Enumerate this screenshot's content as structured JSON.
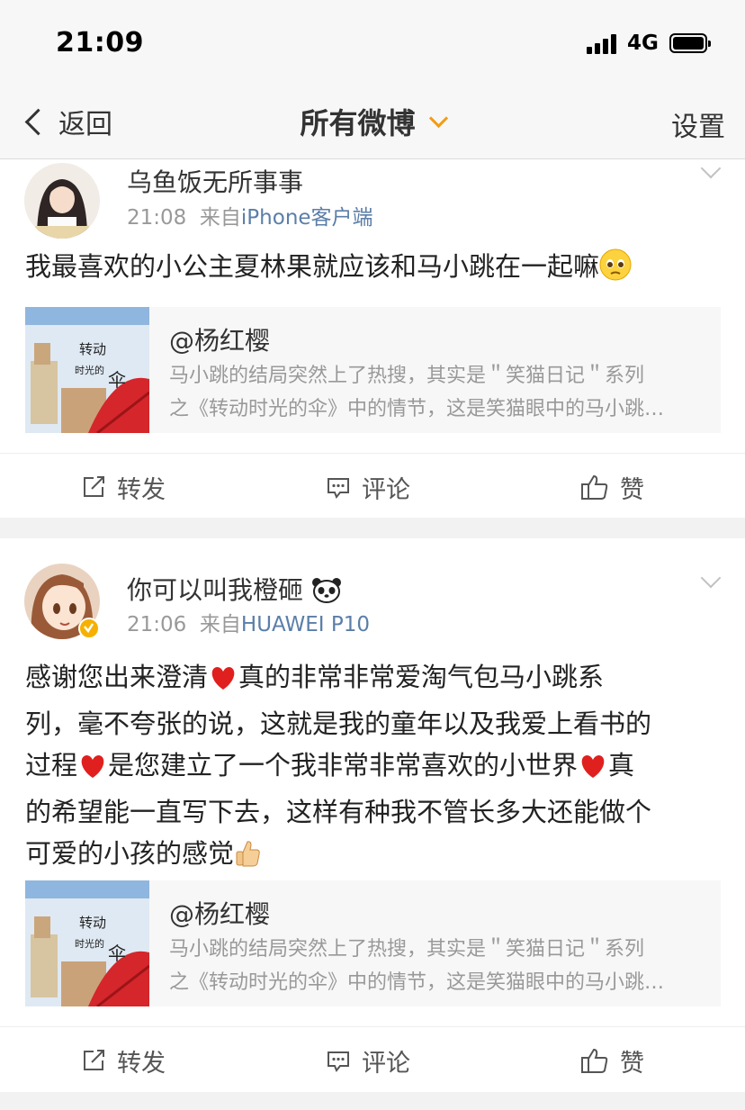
{
  "status": {
    "time": "21:09",
    "network": "4G"
  },
  "nav": {
    "back_label": "返回",
    "title": "所有微博",
    "settings_label": "设置"
  },
  "posts": [
    {
      "author": "乌鱼饭无所事事",
      "time": "21:08",
      "source_prefix": "来自",
      "source": "iPhone客户端",
      "text": "我最喜欢的小公主夏林果就应该和马小跳在一起嘛",
      "emoji": "pleading-emoji",
      "link": {
        "title": "@杨红樱",
        "desc_line1": "马小跳的结局突然上了热搜，其实是＂笑猫日记＂系列",
        "desc_line2": "之《转动时光的伞》中的情节，这是笑猫眼中的马小跳…",
        "thumb_text": "转动时光的伞"
      },
      "actions": {
        "repost": "转发",
        "comment": "评论",
        "like": "赞"
      }
    },
    {
      "author": "你可以叫我橙砸",
      "time": "21:06",
      "source_prefix": "来自",
      "source": "HUAWEI P10",
      "text_lines": [
        "感谢您出来澄清",
        "真的非常非常爱淘气包马小跳系",
        "列，毫不夸张的说，这就是我的童年以及我爱上看书的",
        "过程",
        "是您建立了一个我非常非常喜欢的小世界",
        "真",
        "的希望能一直写下去，这样有种我不管长多大还能做个",
        "可爱的小孩的感觉"
      ],
      "link": {
        "title": "@杨红樱",
        "desc_line1": "马小跳的结局突然上了热搜，其实是＂笑猫日记＂系列",
        "desc_line2": "之《转动时光的伞》中的情节，这是笑猫眼中的马小跳…",
        "thumb_text": "转动时光的伞"
      },
      "actions": {
        "repost": "转发",
        "comment": "评论",
        "like": "赞"
      }
    }
  ],
  "colors": {
    "accent": "#f39c12",
    "link": "#5b7ea8",
    "heart": "#e0201e",
    "verified": "#f6b100"
  }
}
